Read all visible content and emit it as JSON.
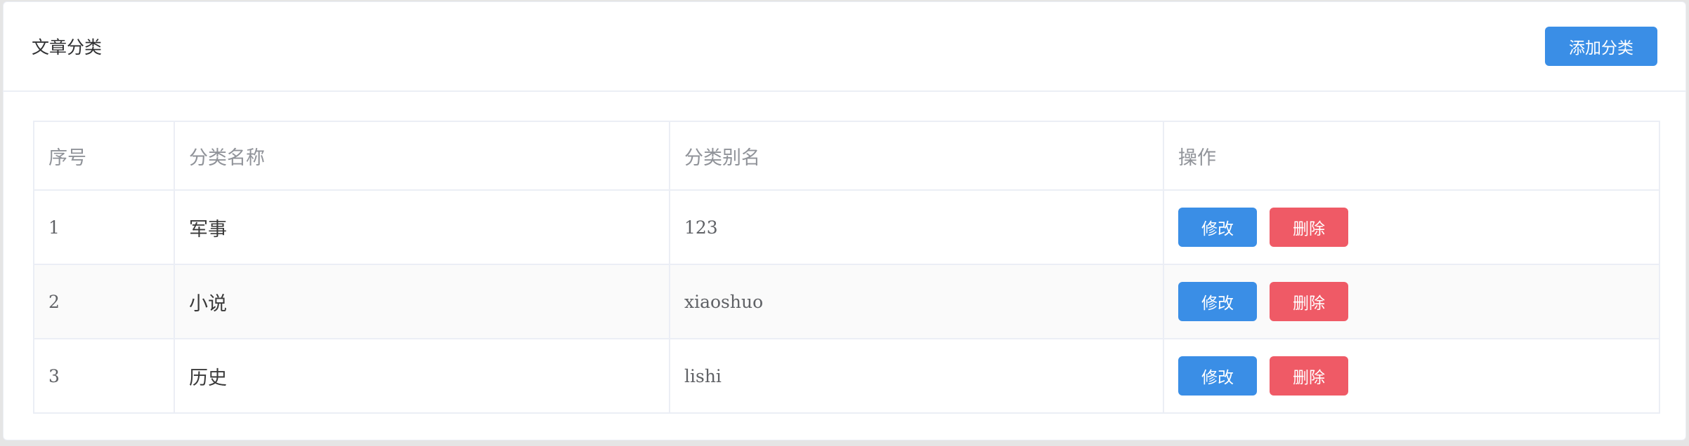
{
  "card": {
    "title": "文章分类",
    "add_button_label": "添加分类"
  },
  "table": {
    "headers": {
      "index": "序号",
      "name": "分类名称",
      "alias": "分类别名",
      "actions": "操作"
    },
    "rows": [
      {
        "index": "1",
        "name": "军事",
        "alias": "123",
        "edit": "修改",
        "delete": "删除"
      },
      {
        "index": "2",
        "name": "小说",
        "alias": "xiaoshuo",
        "edit": "修改",
        "delete": "删除"
      },
      {
        "index": "3",
        "name": "历史",
        "alias": "lishi",
        "edit": "修改",
        "delete": "删除"
      }
    ]
  },
  "colors": {
    "primary": "#3a8ee6",
    "danger": "#ef5a66",
    "border": "#ebeef5",
    "stripe": "#fafafa"
  }
}
